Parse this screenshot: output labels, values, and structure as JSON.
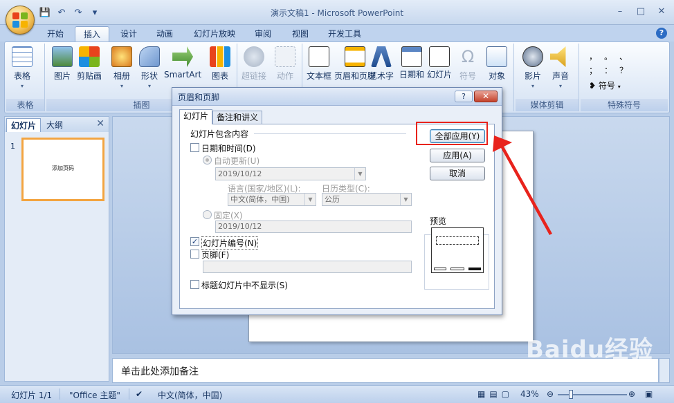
{
  "window": {
    "title": "演示文稿1 - Microsoft PowerPoint",
    "controls": [
      "–",
      "□",
      "✕"
    ]
  },
  "ribbon_tabs": [
    "开始",
    "插入",
    "设计",
    "动画",
    "幻灯片放映",
    "审阅",
    "视图",
    "开发工具"
  ],
  "ribbon": {
    "groups": [
      {
        "label": "表格",
        "buttons": [
          {
            "label": "表格",
            "icon": "table-icon"
          }
        ]
      },
      {
        "label": "插图",
        "buttons": [
          {
            "label": "图片",
            "icon": "picture-icon"
          },
          {
            "label": "剪贴画",
            "icon": "clipart-icon"
          },
          {
            "label": "相册",
            "icon": "photo-album-icon"
          },
          {
            "label": "形状",
            "icon": "shapes-icon"
          },
          {
            "label": "SmartArt",
            "icon": "smartart-icon"
          },
          {
            "label": "图表",
            "icon": "chart-icon"
          }
        ]
      },
      {
        "label": "",
        "buttons": [
          {
            "label": "超链接",
            "icon": "hyperlink-icon"
          },
          {
            "label": "动作",
            "icon": "action-icon"
          }
        ]
      },
      {
        "label": "",
        "buttons": [
          {
            "label": "文本框",
            "icon": "textbox-icon"
          },
          {
            "label": "页眉和页脚",
            "icon": "header-footer-icon"
          },
          {
            "label": "艺术字",
            "icon": "wordart-icon"
          },
          {
            "label": "日期和时间",
            "icon": "datetime-icon"
          },
          {
            "label": "幻灯片编号",
            "icon": "slide-number-icon"
          },
          {
            "label": "符号",
            "icon": "symbol-icon"
          },
          {
            "label": "对象",
            "icon": "object-icon"
          }
        ]
      },
      {
        "label": "媒体剪辑",
        "buttons": [
          {
            "label": "影片",
            "icon": "movie-icon"
          },
          {
            "label": "声音",
            "icon": "sound-icon"
          }
        ]
      },
      {
        "label": "特殊符号",
        "buttons": [
          {
            "label": "符号",
            "icon": "special-symbol-icon"
          }
        ]
      }
    ],
    "special_symbols": [
      "，",
      "。",
      "、",
      "；",
      "：",
      "？"
    ]
  },
  "left_pane": {
    "tabs": [
      "幻灯片",
      "大纲"
    ],
    "close": "✕",
    "slide_number": "1",
    "thumbnail_text": "添加页码"
  },
  "notes_placeholder": "单击此处添加备注",
  "status": {
    "slide": "幻灯片 1/1",
    "theme": "\"Office 主题\"",
    "language": "中文(简体，中国)",
    "zoom": "43%"
  },
  "dialog": {
    "title": "页眉和页脚",
    "help": "?",
    "close": "✕",
    "tabs": [
      "幻灯片",
      "备注和讲义"
    ],
    "section_label": "幻灯片包含内容",
    "datetime_label": "日期和时间(D)",
    "auto_update_label": "自动更新(U)",
    "auto_update_value": "2019/10/12",
    "language_label": "语言(国家/地区)(L):",
    "language_value": "中文(简体，中国)",
    "calendar_label": "日历类型(C):",
    "calendar_value": "公历",
    "fixed_label": "固定(X)",
    "fixed_value": "2019/10/12",
    "slide_number_label": "幻灯片编号(N)",
    "footer_label": "页脚(F)",
    "footer_value": "",
    "hide_title_label": "标题幻灯片中不显示(S)",
    "buttons": {
      "apply_all": "全部应用(Y)",
      "apply": "应用(A)",
      "cancel": "取消"
    },
    "preview_label": "预览"
  },
  "watermark": {
    "main": "Baidu经验",
    "sub": "jingyan.baidu.com"
  },
  "colors": {
    "highlight": "#e8231c",
    "accent_tab": "#f3a440"
  }
}
